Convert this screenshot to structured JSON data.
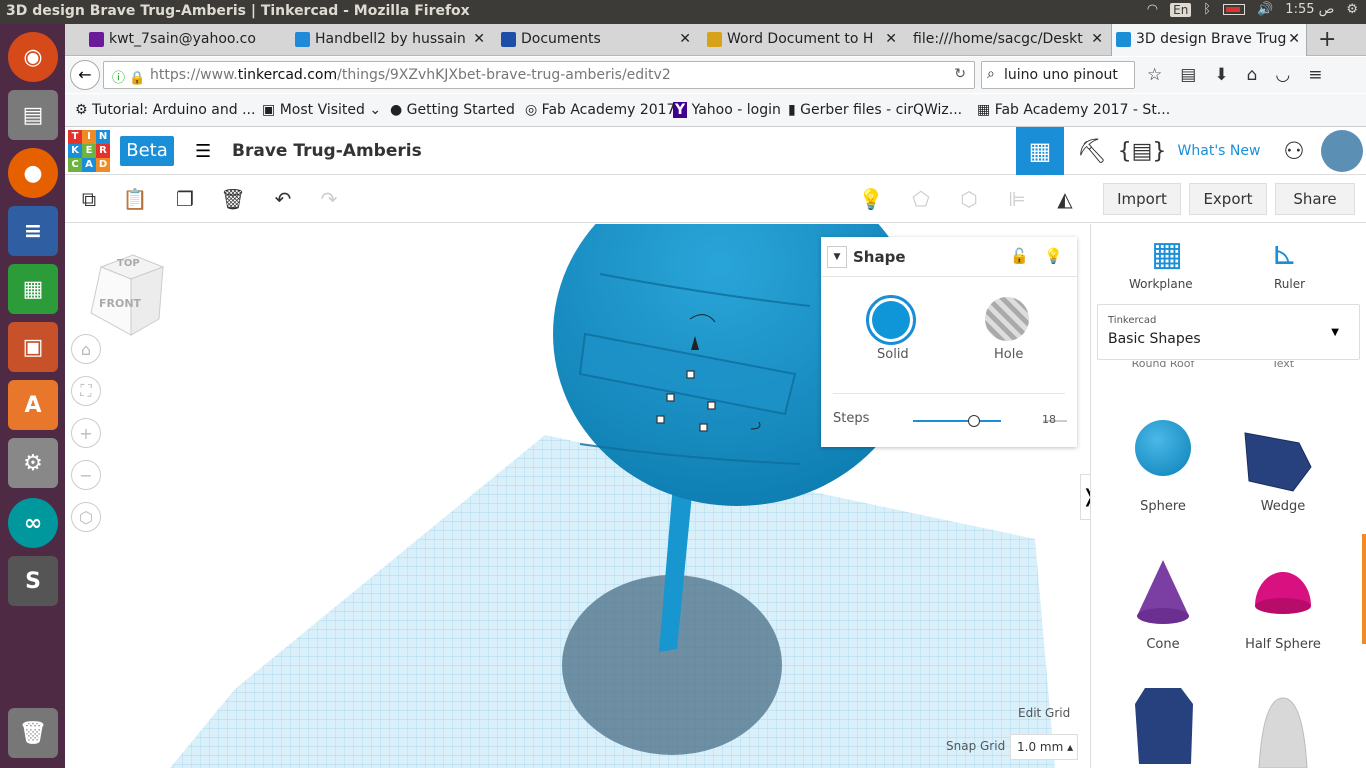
{
  "window": {
    "title": "3D design Brave Trug-Amberis | Tinkercad - Mozilla Firefox"
  },
  "tray": {
    "lang": "En",
    "time": "1:55 ص"
  },
  "tabs": [
    {
      "label": "kwt_7sain@yahoo.co",
      "color": "#6a1b9a"
    },
    {
      "label": "Handbell2 by hussain",
      "color": "#1f8ad9"
    },
    {
      "label": "Documents",
      "color": "#1d4fa8"
    },
    {
      "label": "Word Document to H",
      "color": "#d6a21a"
    },
    {
      "label": "file:///home/sacgc/Deskt",
      "color": "#999999"
    },
    {
      "label": "3D design Brave Trug",
      "color": "#1a8fd8"
    }
  ],
  "url": {
    "prefix": "https://www.",
    "domain": "tinkercad.com",
    "path": "/things/9XZvhKJXbet-brave-trug-amberis/editv2"
  },
  "search": {
    "value": "luino uno pinout"
  },
  "bookmarks": [
    "Tutorial: Arduino and ...",
    "Most Visited",
    "Getting Started",
    "Fab Academy 2017",
    "Yahoo - login",
    "Gerber files - cirQWiz...",
    "Fab Academy 2017 - St..."
  ],
  "logo_letters": [
    "T",
    "I",
    "N",
    "K",
    "E",
    "R",
    "C",
    "A",
    "D"
  ],
  "app": {
    "beta": "Beta",
    "design_name": "Brave Trug-Amberis",
    "whats_new": "What's New"
  },
  "actions": {
    "import": "Import",
    "export": "Export",
    "share": "Share"
  },
  "viewcube": {
    "top": "TOP",
    "front": "FRONT"
  },
  "inspector": {
    "title": "Shape",
    "solid": "Solid",
    "hole": "Hole",
    "steps_label": "Steps",
    "steps_value": "18",
    "steps_fraction": 0.69
  },
  "panel": {
    "workplane": "Workplane",
    "ruler": "Ruler",
    "library_source": "Tinkercad",
    "library_name": "Basic Shapes",
    "partial1": "Round Roof",
    "partial2": "Text"
  },
  "shapes": [
    "Sphere",
    "Wedge",
    "Cone",
    "Half Sphere"
  ],
  "grid": {
    "edit": "Edit Grid",
    "snap_label": "Snap Grid",
    "snap_value": "1.0 mm"
  }
}
